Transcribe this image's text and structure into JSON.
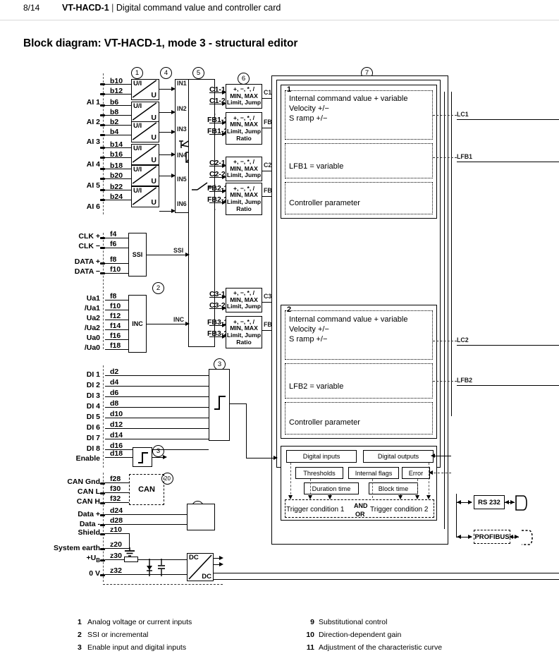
{
  "header": {
    "page_number": "8/14",
    "product": "VT-HACD-1",
    "separator": "|",
    "subtitle": "Digital command value and controller card"
  },
  "diagram_title": "Block diagram: VT-HACD-1, mode 3 - structural editor",
  "analog_inputs": {
    "converter_top": "U/I",
    "converter_bottom": "U",
    "channels": [
      {
        "name": "AI 1",
        "pins": [
          "b10",
          "b12"
        ],
        "out": "IN1"
      },
      {
        "name": "AI 2",
        "pins": [
          "b6",
          "b8"
        ],
        "out": "IN2"
      },
      {
        "name": "AI 3",
        "pins": [
          "b2",
          "b4"
        ],
        "out": "IN3"
      },
      {
        "name": "AI 4",
        "pins": [
          "b14",
          "b16"
        ],
        "out": "IN4"
      },
      {
        "name": "AI 5",
        "pins": [
          "b18",
          "b20"
        ],
        "out": "IN5"
      },
      {
        "name": "AI 6",
        "pins": [
          "b22",
          "b24"
        ],
        "out": "IN6"
      }
    ]
  },
  "markers": {
    "m1": "1",
    "m2": "2",
    "m3": "3",
    "m3b": "3",
    "m4": "4",
    "m5": "5",
    "m6": "6",
    "m7": "7",
    "m20": "20",
    "m21": "21"
  },
  "math_blocks": [
    {
      "inputs": [
        "C1-1",
        "C1-2"
      ],
      "lines": [
        "+, −, *, /",
        "MIN, MAX",
        "Limit, Jump"
      ],
      "out": "C1"
    },
    {
      "inputs": [
        "FB1-1",
        "FB1-2"
      ],
      "lines": [
        "+, −, *, /",
        "MIN, MAX",
        "Limit, Jump",
        "Ratio"
      ],
      "out": "FB1"
    },
    {
      "inputs": [
        "C2-1",
        "C2-2"
      ],
      "lines": [
        "+, −, *, /",
        "MIN, MAX",
        "Limit, Jump"
      ],
      "out": "C2"
    },
    {
      "inputs": [
        "FB2-1",
        "FB2-2"
      ],
      "lines": [
        "+, −, *, /",
        "MIN, MAX",
        "Limit, Jump",
        "Ratio"
      ],
      "out": "FB2"
    },
    {
      "inputs": [
        "C3-1",
        "C3-2"
      ],
      "lines": [
        "+, −, *, /",
        "MIN, MAX",
        "Limit, Jump"
      ],
      "out": "C3"
    },
    {
      "inputs": [
        "FB3-1",
        "FB3-2"
      ],
      "lines": [
        "+, −, *, /",
        "MIN, MAX",
        "Limit, Jump",
        "Ratio"
      ],
      "out": "FB3"
    }
  ],
  "axes": [
    {
      "number": "1",
      "command": [
        "Internal command value + variable",
        "Velocity +/−",
        "S ramp +/−"
      ],
      "feedback": "LFB1 = variable",
      "controller": "Controller parameter",
      "out_command": "LC1",
      "out_feedback": "LFB1"
    },
    {
      "number": "2",
      "command": [
        "Internal command value + variable",
        "Velocity +/−",
        "S ramp +/−"
      ],
      "feedback": "LFB2 = variable",
      "controller": "Controller parameter",
      "out_command": "LC2",
      "out_feedback": "LFB2"
    }
  ],
  "ssi": {
    "block_label": "SSI",
    "out": "SSI",
    "rows": [
      {
        "name": "CLK +",
        "pin": "f4"
      },
      {
        "name": "CLK −",
        "pin": "f6"
      },
      {
        "name": "DATA +",
        "pin": "f8"
      },
      {
        "name": "DATA −",
        "pin": "f10"
      }
    ]
  },
  "inc": {
    "block_label": "INC",
    "out": "INC",
    "rows": [
      {
        "name": "Ua1",
        "pin": "f8"
      },
      {
        "name": "/Ua1",
        "pin": "f10"
      },
      {
        "name": "Ua2",
        "pin": "f12"
      },
      {
        "name": "/Ua2",
        "pin": "f14"
      },
      {
        "name": "Ua0",
        "pin": "f16"
      },
      {
        "name": "/Ua0",
        "pin": "f18"
      }
    ]
  },
  "digital_inputs": {
    "rows": [
      {
        "name": "DI 1",
        "pin": "d2"
      },
      {
        "name": "DI 2",
        "pin": "d4"
      },
      {
        "name": "DI 3",
        "pin": "d6"
      },
      {
        "name": "DI 4",
        "pin": "d8"
      },
      {
        "name": "DI 5",
        "pin": "d10"
      },
      {
        "name": "DI 6",
        "pin": "d12"
      },
      {
        "name": "DI 7",
        "pin": "d14"
      },
      {
        "name": "DI 8",
        "pin": "d16"
      }
    ],
    "enable": {
      "name": "Enable",
      "pin": "d18"
    }
  },
  "bus": {
    "can": {
      "label": "CAN",
      "rows": [
        {
          "name": "CAN Gnd",
          "pin": "f28"
        },
        {
          "name": "CAN L",
          "pin": "f30"
        },
        {
          "name": "CAN H",
          "pin": "f32"
        }
      ]
    },
    "serial": {
      "rows": [
        {
          "name": "Data +",
          "pin": "d24"
        },
        {
          "name": "Data -",
          "pin": "d28"
        }
      ]
    },
    "ground": {
      "rows": [
        {
          "name": "Shield",
          "pin": "z10"
        },
        {
          "name": "System earth",
          "pin": "z20"
        }
      ]
    },
    "power": {
      "rows": [
        {
          "name": "+U",
          "sub": "B",
          "pin": "z30"
        },
        {
          "name": "0 V",
          "sub": "",
          "pin": "z32"
        }
      ],
      "converter_top": "DC",
      "converter_bottom": "DC"
    }
  },
  "logic_block": {
    "digital_inputs": "Digital inputs",
    "digital_outputs": "Digital outputs",
    "thresholds": "Thresholds",
    "internal_flags": "Internal flags",
    "error": "Error",
    "duration_time": "Duration time",
    "block_time": "Block time",
    "trigger1": "Trigger condition 1",
    "operator": [
      "AND",
      "OR"
    ],
    "trigger2": "Trigger condition 2"
  },
  "interfaces": {
    "rs232": "RS 232",
    "profibus": "PROFIBUS"
  },
  "legend": {
    "left": [
      {
        "n": "1",
        "t": "Analog voltage or current inputs"
      },
      {
        "n": "2",
        "t": "SSI or incremental"
      },
      {
        "n": "3",
        "t": "Enable input and digital inputs"
      }
    ],
    "right": [
      {
        "n": "9",
        "t": "Substitutional control"
      },
      {
        "n": "10",
        "t": "Direction-dependent gain"
      },
      {
        "n": "11",
        "t": "Adjustment of the characteristic curve"
      }
    ]
  }
}
